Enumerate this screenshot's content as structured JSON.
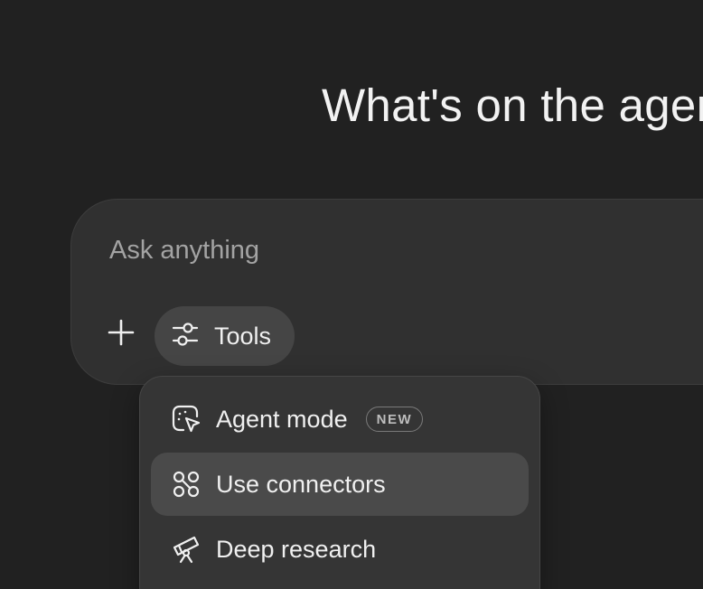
{
  "headline": "What's on the agenda today?",
  "composer": {
    "placeholder": "Ask anything",
    "value": "",
    "plus_icon": "plus-icon",
    "tools_label": "Tools",
    "tools_icon": "sliders-icon"
  },
  "tools_menu": {
    "items": [
      {
        "label": "Agent mode",
        "icon": "agent-cursor-icon",
        "badge": "NEW",
        "highlighted": false
      },
      {
        "label": "Use connectors",
        "icon": "connectors-icon",
        "badge": "",
        "highlighted": true
      },
      {
        "label": "Deep research",
        "icon": "telescope-icon",
        "badge": "",
        "highlighted": false
      }
    ]
  },
  "colors": {
    "background": "#212121",
    "composer": "#303030",
    "tools_button": "#454545",
    "menu": "#353535",
    "menu_highlight": "#4a4a4a",
    "text": "#ececec",
    "placeholder": "#a3a3a3"
  }
}
